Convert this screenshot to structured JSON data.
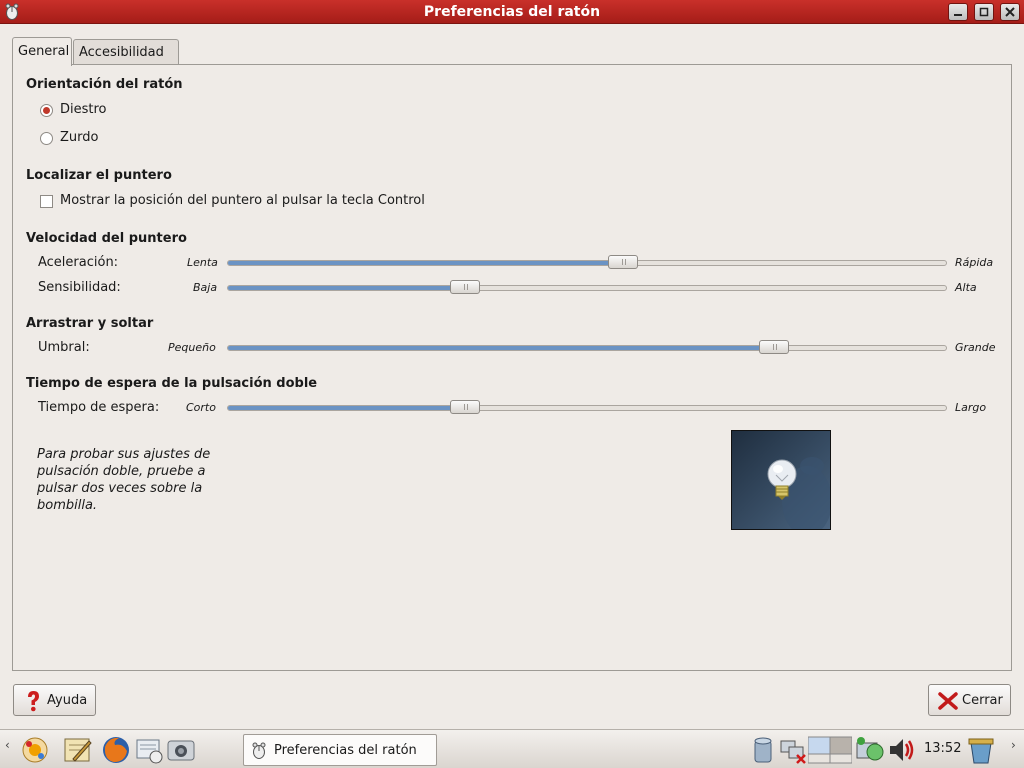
{
  "window": {
    "title": "Preferencias del ratón",
    "icons": {
      "app": "mouse-icon",
      "minimize": "minimize-icon",
      "maximize": "maximize-icon",
      "close": "close-icon"
    }
  },
  "tabs": [
    {
      "label": "General",
      "active": true
    },
    {
      "label": "Accesibilidad",
      "active": false
    }
  ],
  "orientation": {
    "title": "Orientación del ratón",
    "right_label": "Diestro",
    "left_label": "Zurdo",
    "selected": "right"
  },
  "locate": {
    "title": "Localizar el puntero",
    "checkbox_label": "Mostrar la posición del puntero al pulsar la tecla Control",
    "checked": false
  },
  "speed": {
    "title": "Velocidad del puntero",
    "acceleration": {
      "label": "Aceleración:",
      "min_label": "Lenta",
      "max_label": "Rápida",
      "value": 0.55
    },
    "sensitivity": {
      "label": "Sensibilidad:",
      "min_label": "Baja",
      "max_label": "Alta",
      "value": 0.33
    }
  },
  "drag": {
    "title": "Arrastrar y soltar",
    "threshold": {
      "label": "Umbral:",
      "min_label": "Pequeño",
      "max_label": "Grande",
      "value": 0.76
    }
  },
  "double_click": {
    "title": "Tiempo de espera de la pulsación doble",
    "timeout": {
      "label": "Tiempo de espera:",
      "min_label": "Corto",
      "max_label": "Largo",
      "value": 0.33
    },
    "test_text": "Para probar sus ajustes de pulsación doble, pruebe a pulsar dos veces sobre la bombilla.",
    "bulb_icon": "lightbulb-icon"
  },
  "buttons": {
    "help": "Ayuda",
    "close": "Cerrar"
  },
  "taskbar": {
    "task_label": "Preferencias del ratón",
    "clock": "13:52"
  },
  "colors": {
    "titlebar": "#b3231d",
    "slider_fill": "#6b93c4",
    "radio_dot": "#c0392b"
  }
}
